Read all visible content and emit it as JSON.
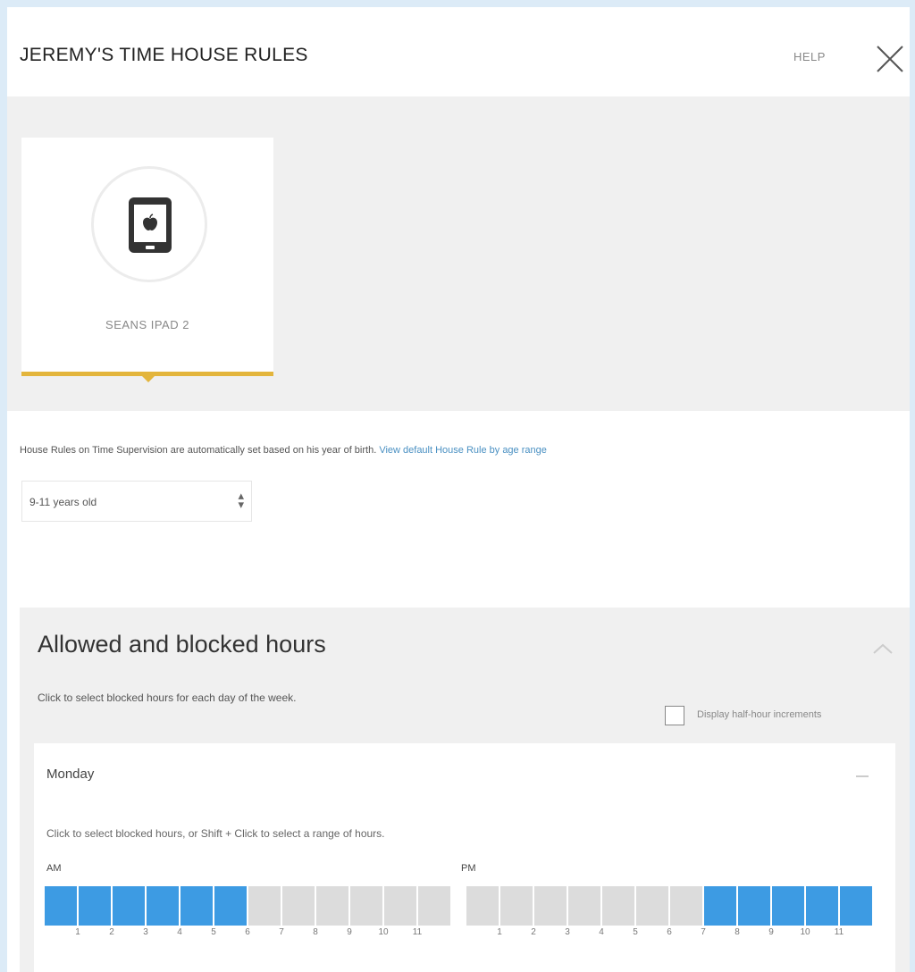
{
  "header": {
    "title": "JEREMY'S TIME HOUSE RULES",
    "help_label": "HELP"
  },
  "device": {
    "name": "SEANS IPAD 2",
    "icon": "tablet-apple-icon"
  },
  "info": {
    "text": "House Rules on Time Supervision are automatically set based on his year of birth. ",
    "link": "View default House Rule by age range"
  },
  "age_select": {
    "value": "9-11 years old"
  },
  "hours": {
    "title": "Allowed and blocked hours",
    "subtitle": "Click to select blocked hours for each day of the week.",
    "half_hour_label": "Display half-hour increments",
    "half_hour_checked": false
  },
  "day": {
    "name": "Monday",
    "instruction": "Click to select blocked hours, or Shift + Click to select a range of hours.",
    "am_label": "AM",
    "pm_label": "PM",
    "am_ticks": [
      "1",
      "2",
      "3",
      "4",
      "5",
      "6",
      "7",
      "8",
      "9",
      "10",
      "11"
    ],
    "pm_ticks": [
      "1",
      "2",
      "3",
      "4",
      "5",
      "6",
      "7",
      "8",
      "9",
      "10",
      "11"
    ],
    "blocked_hours": [
      0,
      1,
      2,
      3,
      4,
      5,
      19,
      20,
      21,
      22,
      23
    ],
    "colors": {
      "blocked": "#3d9be3",
      "allowed": "#dcdcdc",
      "accent": "#e3b53c"
    }
  }
}
